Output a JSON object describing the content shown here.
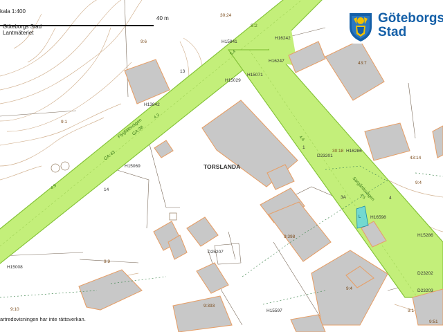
{
  "scale": {
    "label": "kala 1:400",
    "distance": "40 m"
  },
  "org_lines": [
    "Göteborgs Stad",
    "Lantmäteriet"
  ],
  "logo": {
    "line1": "Göteborgs",
    "line2": "Stad"
  },
  "district_label": "TORSLANDA",
  "disclaimer": "artredovisningen har inte rättsverkan.",
  "colors": {
    "road": "#c3ef7a",
    "road_edge": "#86c43a",
    "building": "#c8c8c8",
    "parcel": "#e6a06a",
    "highlight": "#5fd3e6",
    "logo_blue": "#1560a8"
  },
  "parcel_labels": [
    {
      "t": "30:24"
    },
    {
      "t": "S:2"
    },
    {
      "t": "9:6"
    },
    {
      "t": "H16242"
    },
    {
      "t": "H15841"
    },
    {
      "t": "H16247"
    },
    {
      "t": "43:7"
    },
    {
      "t": "13"
    },
    {
      "t": "H15071"
    },
    {
      "t": "H15029"
    },
    {
      "t": "H13842"
    },
    {
      "t": "9:1"
    },
    {
      "t": "30:18"
    },
    {
      "t": "H16286"
    },
    {
      "t": "43:14"
    },
    {
      "t": "D23201"
    },
    {
      "t": "9:4"
    },
    {
      "t": "H15069"
    },
    {
      "t": "14"
    },
    {
      "t": "3A"
    },
    {
      "t": "4"
    },
    {
      "t": "H16598"
    },
    {
      "t": "H15286"
    },
    {
      "t": "9:398"
    },
    {
      "t": "D25207"
    },
    {
      "t": "H15008"
    },
    {
      "t": "9:9"
    },
    {
      "t": "9:393"
    },
    {
      "t": "D23202"
    },
    {
      "t": "D23203"
    },
    {
      "t": "9:10"
    },
    {
      "t": "H15597"
    },
    {
      "t": "9:1"
    },
    {
      "t": "9:51"
    },
    {
      "t": "1"
    },
    {
      "t": "9:4"
    }
  ],
  "road_labels": [
    {
      "t": "GA:43"
    },
    {
      "t": "GA:38"
    },
    {
      "t": "Flygfältsvägen"
    },
    {
      "t": "Sörgårdsvägen"
    }
  ],
  "misc_labels": [
    {
      "t": "4.9"
    },
    {
      "t": "4.6"
    },
    {
      "t": "4.5"
    },
    {
      "t": "5.4"
    },
    {
      "t": "4.3"
    },
    {
      "t": "L"
    }
  ]
}
